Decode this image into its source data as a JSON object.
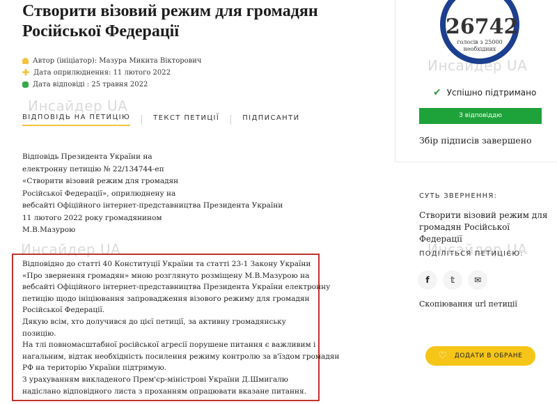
{
  "petition": {
    "title": "Створити візовий режим для громадян Російської Федерації",
    "author": "Автор (ініціатор): Мазура Микита Вікторович",
    "published": "Дата оприлюднення: 11 лютого 2022",
    "answered": "Дата відповіді : 25 травня 2022"
  },
  "watermark": "Инсайдер UA",
  "tabs": [
    {
      "label": "ВІДПОВІДЬ НА ПЕТИЦІЮ"
    },
    {
      "label": "ТЕКСТ ПЕТИЦІЇ"
    },
    {
      "label": "ПІДПИСАНТИ"
    }
  ],
  "answer_intro": [
    "Відповідь Президента України на",
    "електронну петицію № 22/134744-еп",
    "«Створити візовий режим для громадян",
    "Російської Федерації», оприлюднену на",
    "вебсайті Офіційного інтернет-представництва Президента України",
    "11 лютого 2022 року громадянином",
    "М.В.Мазурою"
  ],
  "answer_body": [
    "Відповідно до статті 40 Конституції України та статті 23-1 Закону України",
    "«Про звернення громадян» мною розглянуто розміщену М.В.Мазурою на",
    "вебсайті Офіційного інтернет-представництва Президента України електронну",
    "петицію щодо ініціювання запровадження візового режиму для громадян",
    "Російської Федерації.",
    "Дякую всім, хто долучився до цієї петиції, за активну громадянську",
    "позицію.",
    "На тлі повномасштабної російської агресії порушене питання є важливим і",
    "нагальним, відтак необхідність посилення режиму контролю за в'їздом громадян",
    "РФ на територію України підтримую.",
    "З урахуванням викладеного Прем'єр-міністрові України Д.Шмигалю",
    "надіслано відповідного листа з проханням опрацювати вказане питання."
  ],
  "sidebar": {
    "votes": "26742",
    "votes_sub1": "голосів з 25000",
    "votes_sub2": "необхідних",
    "status": "Успішно підтримано",
    "status_bar": "З відповіддю",
    "collected": "Збір підписів завершено",
    "essence_heading": "СУТЬ ЗВЕРНЕННЯ:",
    "essence": "Створити візовий режим для громадян Російської Федерації",
    "share_heading": "ПОДІЛІТЬСЯ ПЕТИЦІЄЮ:",
    "socials": [
      {
        "icon": "facebook-icon",
        "glyph": "f"
      },
      {
        "icon": "twitter-icon",
        "glyph": "𝕥"
      },
      {
        "icon": "email-icon",
        "glyph": "✉"
      }
    ],
    "copy_url": "Скопіювання url петиції",
    "favorite": "ДОДАТИ В ОБРАНЕ"
  },
  "colors": {
    "accent": "#f3c33b",
    "success": "#1ea33a",
    "counter_ring": "#1c3f8f",
    "highlight_box": "#c0332b"
  }
}
